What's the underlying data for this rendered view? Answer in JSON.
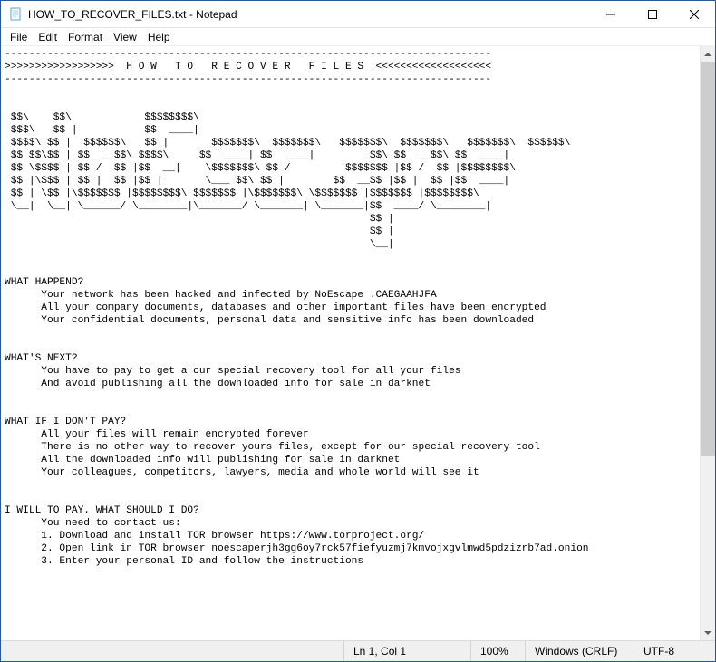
{
  "window": {
    "title": "HOW_TO_RECOVER_FILES.txt - Notepad"
  },
  "menu": {
    "file": "File",
    "edit": "Edit",
    "format": "Format",
    "view": "View",
    "help": "Help"
  },
  "content": "--------------------------------------------------------------------------------\n>>>>>>>>>>>>>>>>>>  H O W   T O   R E C O V E R   F I L E S  <<<<<<<<<<<<<<<<<<<\n--------------------------------------------------------------------------------\n\n\n $$\\    $$\\            $$$$$$$$\\ \n $$$\\   $$ |           $$  ____|\n $$$$\\ $$ |  $$$$$$\\   $$ |       $$$$$$$\\  $$$$$$$\\   $$$$$$$\\  $$$$$$$\\   $$$$$$$\\  $$$$$$\\ \n $$ $$\\$$ | $$  __$$\\ $$$$\\     $$  ____| $$  ____|        _$$\\ $$  __$$\\ $$  ____|\n $$ \\$$$$ | $$ /  $$ |$$  __|    \\$$$$$$$\\ $$ /         $$$$$$$ |$$ /  $$ |$$$$$$$$\\ \n $$ |\\$$$ | $$ |  $$ |$$ |       \\___ $$\\ $$ |        $$  __$$ |$$ |  $$ |$$  ____|\n $$ | \\$$ |\\$$$$$$$ |$$$$$$$$\\ $$$$$$$ |\\$$$$$$$\\ \\$$$$$$$ |$$$$$$$ |$$$$$$$$\\ \n \\__|  \\__| \\______/ \\________|\\_______/ \\_______| \\_______|$$  ____/ \\________|\n                                                            $$ |\n                                                            $$ |\n                                                            \\__|\n\n\nWHAT HAPPEND?\n      Your network has been hacked and infected by NoEscape .CAEGAAHJFA\n      All your company documents, databases and other important files have been encrypted\n      Your confidential documents, personal data and sensitive info has been downloaded\n\n\nWHAT'S NEXT?\n      You have to pay to get a our special recovery tool for all your files\n      And avoid publishing all the downloaded info for sale in darknet\n\n\nWHAT IF I DON'T PAY?\n      All your files will remain encrypted forever\n      There is no other way to recover yours files, except for our special recovery tool\n      All the downloaded info will publishing for sale in darknet\n      Your colleagues, competitors, lawyers, media and whole world will see it\n\n\nI WILL TO PAY. WHAT SHOULD I DO?\n      You need to contact us:\n      1. Download and install TOR browser https://www.torproject.org/\n      2. Open link in TOR browser noescaperjh3gg6oy7rck57fiefyuzmj7kmvojxgvlmwd5pdzizrb7ad.onion\n      3. Enter your personal ID and follow the instructions",
  "status": {
    "position": "Ln 1, Col 1",
    "zoom": "100%",
    "lineending": "Windows (CRLF)",
    "encoding": "UTF-8"
  }
}
